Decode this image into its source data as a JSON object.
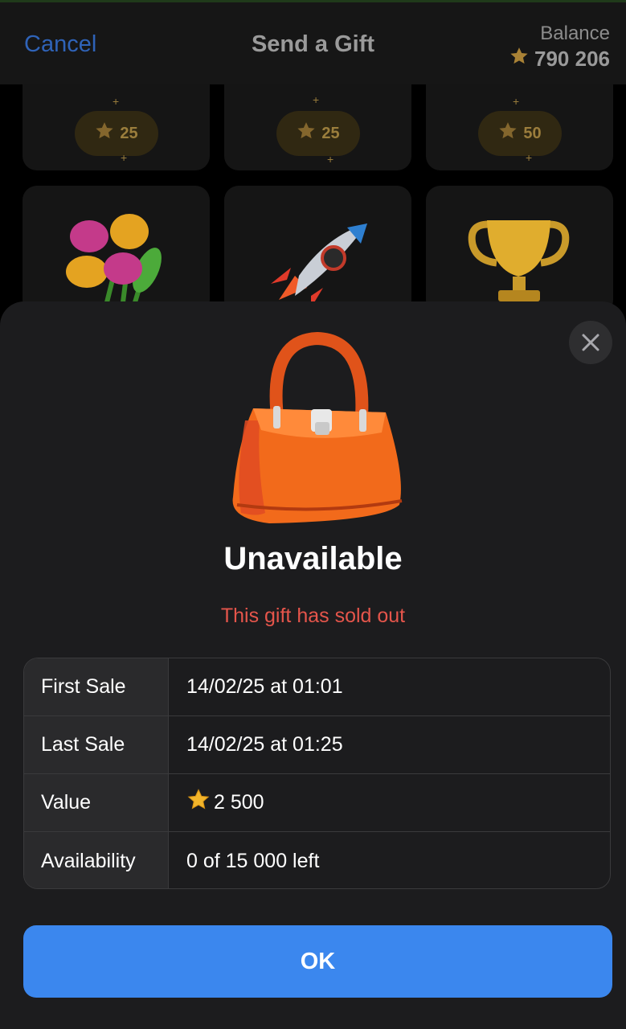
{
  "header": {
    "cancel_label": "Cancel",
    "title": "Send a Gift",
    "balance_label": "Balance",
    "balance_value": "790 206"
  },
  "grid": {
    "prices": [
      "25",
      "25",
      "50"
    ],
    "gift_icons": [
      "tulip-bouquet-icon",
      "rocket-icon",
      "trophy-icon"
    ]
  },
  "modal": {
    "heading": "Unavailable",
    "subheading": "This gift has sold out",
    "gift_icon": "handbag-icon",
    "details": [
      {
        "label": "First Sale",
        "value": "14/02/25 at 01:01"
      },
      {
        "label": "Last Sale",
        "value": "14/02/25 at 01:25"
      },
      {
        "label": "Value",
        "value": "2 500"
      },
      {
        "label": "Availability",
        "value": "0 of 15 000 left"
      }
    ],
    "ok_label": "OK"
  },
  "colors": {
    "accent_blue": "#3b87ee",
    "error_red": "#e5554b",
    "star_gold": "#f2b52b",
    "bag_orange": "#f26a1b"
  }
}
